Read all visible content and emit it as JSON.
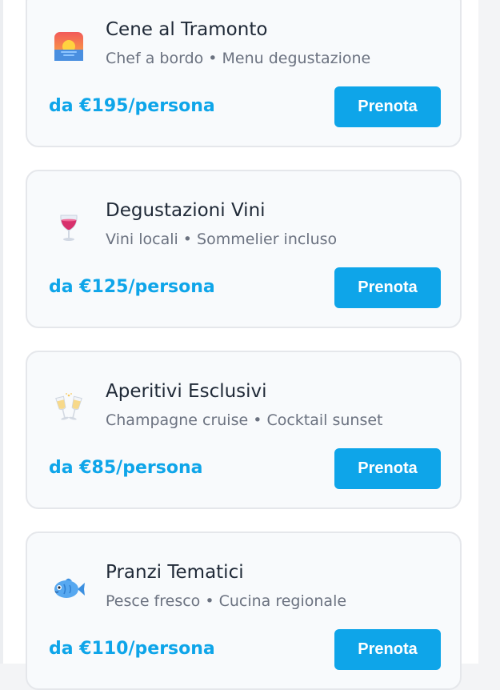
{
  "experiences": [
    {
      "title": "Cene al Tramonto",
      "subtitle": "Chef a bordo • Menu degustazione",
      "price": "da €195/persona",
      "button_label": "Prenota",
      "icon": "sunset-icon"
    },
    {
      "title": "Degustazioni Vini",
      "subtitle": "Vini locali • Sommelier incluso",
      "price": "da €125/persona",
      "button_label": "Prenota",
      "icon": "wine-glass-icon"
    },
    {
      "title": "Aperitivi Esclusivi",
      "subtitle": "Champagne cruise • Cocktail sunset",
      "price": "da €85/persona",
      "button_label": "Prenota",
      "icon": "champagne-glasses-icon"
    },
    {
      "title": "Pranzi Tematici",
      "subtitle": "Pesce fresco • Cucina regionale",
      "price": "da €110/persona",
      "button_label": "Prenota",
      "icon": "fish-icon"
    }
  ],
  "colors": {
    "accent": "#0ea5e9",
    "title": "#1f2937",
    "subtitle": "#6b7280",
    "card_bg": "#f8fafc",
    "card_border": "#e5e7eb"
  }
}
